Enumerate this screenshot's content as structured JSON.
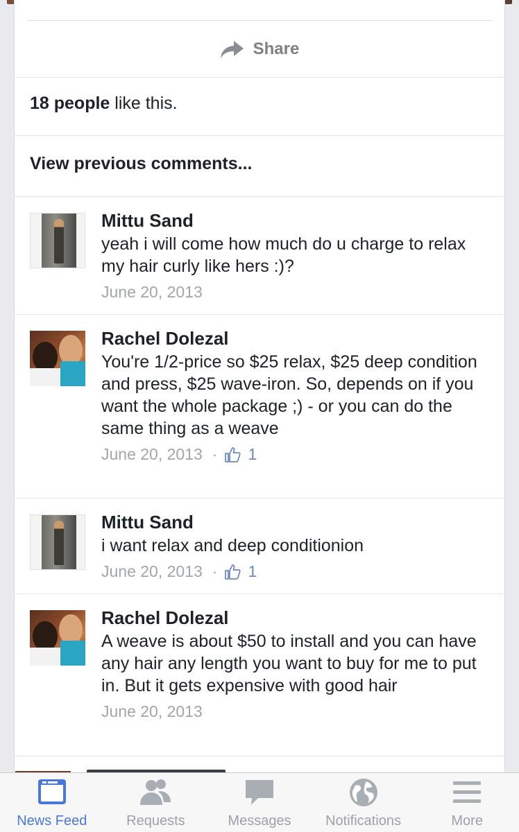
{
  "post": {
    "share_label": "Share",
    "likes_count": "18 people",
    "likes_suffix": " like this.",
    "view_previous": "View previous comments..."
  },
  "comments": [
    {
      "author": "Mittu Sand",
      "text": "yeah i will come how much do u charge to relax my hair curly like hers :)?",
      "date": "June 20, 2013",
      "likes": ""
    },
    {
      "author": "Rachel Dolezal",
      "text": "You're 1/2-price so $25 relax, $25 deep condition and press, $25 wave-iron. So, depends on if you want the whole package ;) - or you can do the same thing as a weave",
      "date": "June 20, 2013",
      "likes": "1"
    },
    {
      "author": "Mittu Sand",
      "text": "i want relax and deep conditionion",
      "date": "June 20, 2013",
      "likes": "1"
    },
    {
      "author": "Rachel Dolezal",
      "text": "A weave is about $50 to install and you can have any hair any length you want to buy for me to put in. But it gets expensive with good hair",
      "date": "June 20, 2013",
      "likes": ""
    }
  ],
  "tabbar": {
    "items": [
      {
        "label": "News Feed",
        "icon": "news-feed-icon",
        "active": true
      },
      {
        "label": "Requests",
        "icon": "friend-requests-icon",
        "active": false
      },
      {
        "label": "Messages",
        "icon": "messages-icon",
        "active": false
      },
      {
        "label": "Notifications",
        "icon": "globe-icon",
        "active": false
      },
      {
        "label": "More",
        "icon": "hamburger-menu-icon",
        "active": false
      }
    ]
  },
  "colors": {
    "accent": "#4a78d8",
    "muted": "#9da1a8",
    "text": "#1d2129",
    "background": "#e9eaee"
  }
}
